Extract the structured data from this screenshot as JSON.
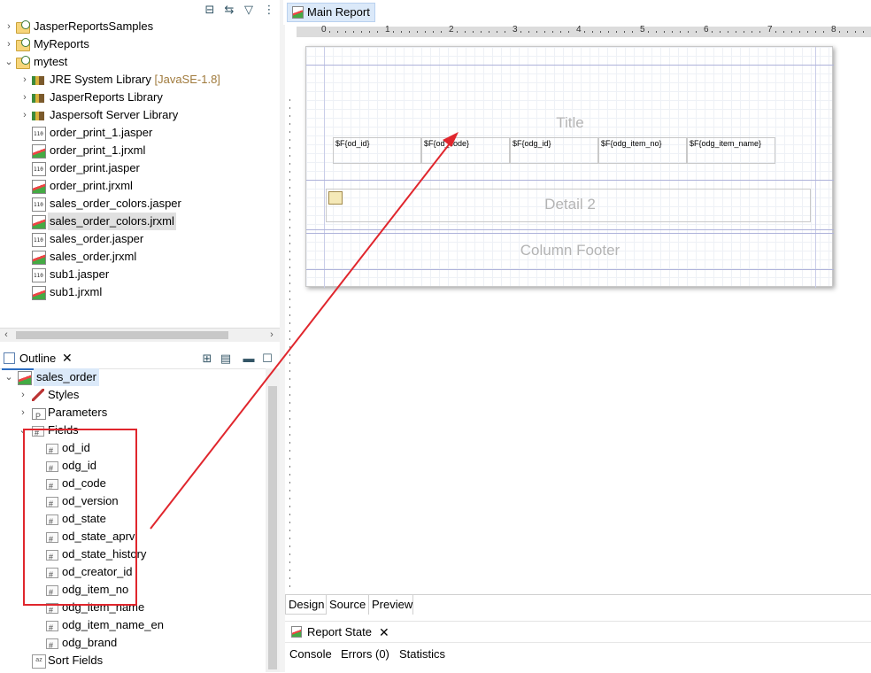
{
  "explorer": {
    "items": [
      {
        "label": "JasperReportsSamples",
        "icon": "project-folder-icon",
        "twisty": "collapsed",
        "level": 0
      },
      {
        "label": "MyReports",
        "icon": "project-folder-icon",
        "twisty": "collapsed",
        "level": 0
      },
      {
        "label": "mytest",
        "icon": "project-folder-icon",
        "twisty": "expanded",
        "level": 0
      },
      {
        "label": "JRE System Library",
        "hint": "[JavaSE-1.8]",
        "icon": "library-icon",
        "twisty": "collapsed",
        "level": 1
      },
      {
        "label": "JasperReports Library",
        "icon": "library-icon",
        "twisty": "collapsed",
        "level": 1
      },
      {
        "label": "Jaspersoft Server Library",
        "icon": "library-icon",
        "twisty": "collapsed",
        "level": 1
      },
      {
        "label": "order_print_1.jasper",
        "icon": "jasper-file-icon",
        "level": 1
      },
      {
        "label": "order_print_1.jrxml",
        "icon": "jrxml-file-icon",
        "level": 1
      },
      {
        "label": "order_print.jasper",
        "icon": "jasper-file-icon",
        "level": 1
      },
      {
        "label": "order_print.jrxml",
        "icon": "jrxml-file-icon",
        "level": 1
      },
      {
        "label": "sales_order_colors.jasper",
        "icon": "jasper-file-icon",
        "level": 1
      },
      {
        "label": "sales_order_colors.jrxml",
        "icon": "jrxml-file-icon",
        "level": 1,
        "selected": true
      },
      {
        "label": "sales_order.jasper",
        "icon": "jasper-file-icon",
        "level": 1
      },
      {
        "label": "sales_order.jrxml",
        "icon": "jrxml-file-icon",
        "level": 1
      },
      {
        "label": "sub1.jasper",
        "icon": "jasper-file-icon",
        "level": 1
      },
      {
        "label": "sub1.jrxml",
        "icon": "jrxml-file-icon",
        "level": 1
      }
    ]
  },
  "outline": {
    "tab_label": "Outline",
    "root": "sales_order",
    "nodes": [
      {
        "label": "Styles",
        "icon": "styles-icon"
      },
      {
        "label": "Parameters",
        "icon": "parameters-icon"
      },
      {
        "label": "Fields",
        "icon": "fields-icon"
      }
    ],
    "fields": [
      "od_id",
      "odg_id",
      "od_code",
      "od_version",
      "od_state",
      "od_state_aprv",
      "od_state_history",
      "od_creator_id",
      "odg_item_no",
      "odg_item_name",
      "odg_item_name_en",
      "odg_brand"
    ],
    "sort_fields": "Sort Fields"
  },
  "editor": {
    "tab_label": "Main Report",
    "ruler_labels": [
      "0",
      "1",
      "2",
      "3",
      "4",
      "5",
      "6",
      "7",
      "8"
    ],
    "bands": {
      "title": "Title",
      "detail": "Detail 2",
      "column_footer": "Column Footer"
    },
    "field_cells": [
      "$F{od_id}",
      "$F{od_code}",
      "$F{odg_id}",
      "$F{odg_item_no}",
      "$F{odg_item_name}"
    ],
    "bottom_tabs": [
      "Design",
      "Source",
      "Preview"
    ],
    "active_bottom_tab": "Design"
  },
  "report_state": {
    "tab_label": "Report State",
    "sub_tabs": [
      "Console",
      "Errors (0)",
      "Statistics"
    ]
  },
  "colors": {
    "annotation_red": "#e0262d",
    "selection_blue": "#2d6ec2"
  }
}
